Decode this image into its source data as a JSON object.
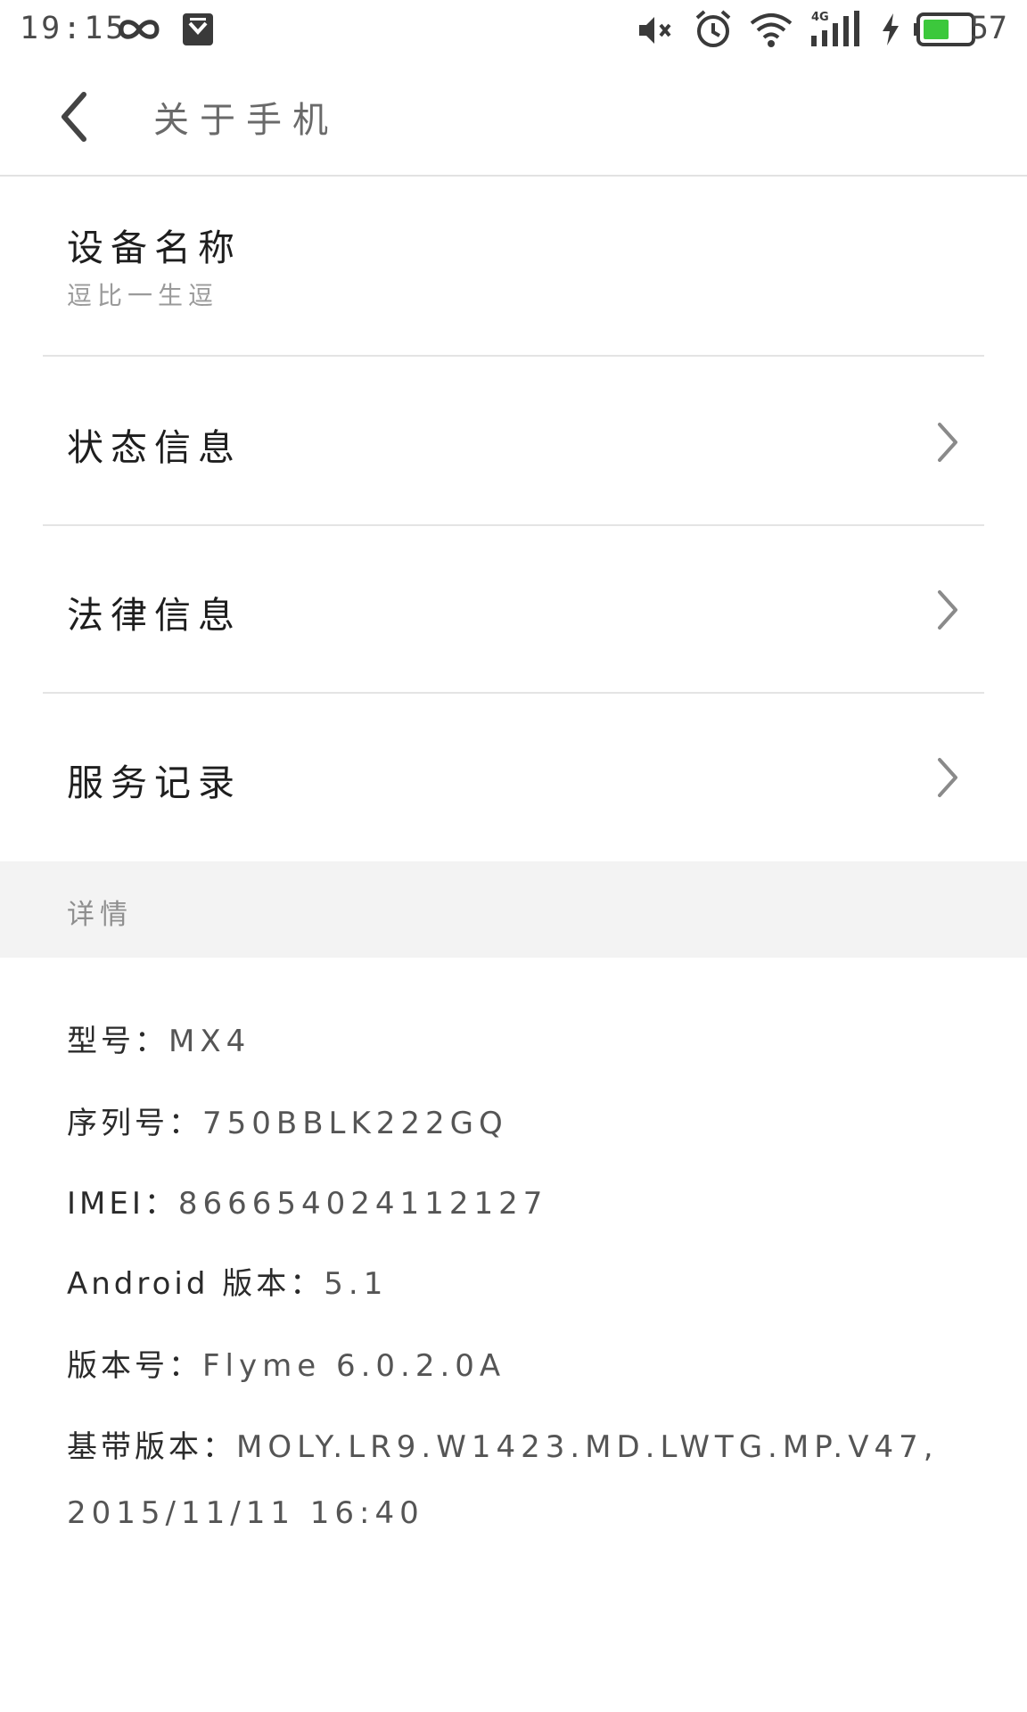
{
  "status_bar": {
    "time": "19:15",
    "icons": [
      "infinity-icon",
      "shield-icon",
      "mute-icon",
      "alarm-icon",
      "wifi-icon",
      "signal-4g-icon",
      "charging-icon",
      "battery-icon"
    ],
    "network_type": "4G",
    "battery_percent": "57",
    "battery_level": 0.57,
    "battery_color": "#3cc83c"
  },
  "header": {
    "title": "关于手机"
  },
  "items": [
    {
      "label": "设备名称",
      "value": "逗比一生逗"
    },
    {
      "label": "状态信息"
    },
    {
      "label": "法律信息"
    },
    {
      "label": "服务记录"
    }
  ],
  "section": {
    "title": "详情"
  },
  "details": {
    "model_label": "型号：",
    "model_value": "MX4",
    "serial_label": "序列号：",
    "serial_value": "750BBLK222GQ",
    "imei_label": "IMEI：",
    "imei_value": "866654024112127",
    "android_label": "Android 版本：",
    "android_value": "5.1",
    "build_label": "版本号：",
    "build_value": "Flyme 6.0.2.0A",
    "baseband_label": "基带版本：",
    "baseband_value": "MOLY.LR9.W1423.MD.LWTG.MP.V47, 2015/11/11 16:40"
  }
}
